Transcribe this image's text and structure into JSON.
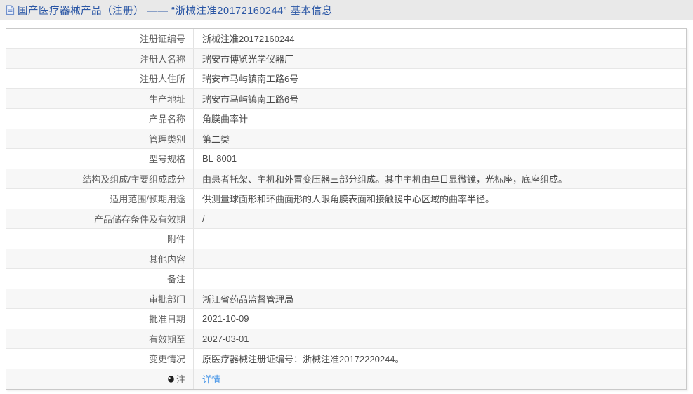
{
  "header": {
    "title": "国产医疗器械产品（注册） —— “浙械注准20172160244” 基本信息",
    "icon": "document-icon"
  },
  "colors": {
    "header_text": "#2a56a5",
    "header_bg": "#e9e9e9",
    "link": "#4796e8",
    "row_alt_bg": "#f7f7f7",
    "table_border": "#c9c9c9"
  },
  "table": {
    "rows": [
      {
        "label": "注册证编号",
        "value": "浙械注准20172160244"
      },
      {
        "label": "注册人名称",
        "value": "瑞安市博览光学仪器厂"
      },
      {
        "label": "注册人住所",
        "value": "瑞安市马屿镇南工路6号"
      },
      {
        "label": "生产地址",
        "value": "瑞安市马屿镇南工路6号"
      },
      {
        "label": "产品名称",
        "value": "角膜曲率计"
      },
      {
        "label": "管理类别",
        "value": "第二类"
      },
      {
        "label": "型号规格",
        "value": "BL-8001"
      },
      {
        "label": "结构及组成/主要组成成分",
        "value": "由患者托架、主机和外置变压器三部分组成。其中主机由单目显微镜，光标座，底座组成。"
      },
      {
        "label": "适用范围/预期用途",
        "value": "供测量球面形和环曲面形的人眼角膜表面和接触镜中心区域的曲率半径。"
      },
      {
        "label": "产品储存条件及有效期",
        "value": "/"
      },
      {
        "label": "附件",
        "value": ""
      },
      {
        "label": "其他内容",
        "value": ""
      },
      {
        "label": "备注",
        "value": ""
      },
      {
        "label": "审批部门",
        "value": "浙江省药品监督管理局"
      },
      {
        "label": "批准日期",
        "value": "2021-10-09"
      },
      {
        "label": "有效期至",
        "value": "2027-03-01"
      },
      {
        "label": "变更情况",
        "value": "原医疗器械注册证编号：浙械注准20172220244。"
      },
      {
        "label": "注",
        "icon": "note-icon",
        "link": "详情"
      }
    ]
  }
}
